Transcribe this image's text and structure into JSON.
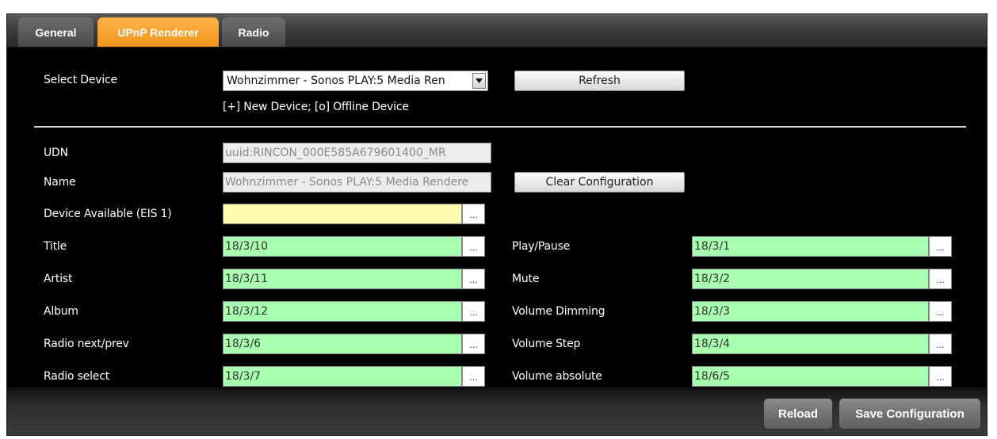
{
  "tabs": [
    {
      "label": "General",
      "active": false
    },
    {
      "label": "UPnP Renderer",
      "active": true
    },
    {
      "label": "Radio",
      "active": false
    }
  ],
  "select_device": {
    "label": "Select Device",
    "value": "Wohnzimmer - Sonos PLAY:5 Media Ren",
    "refresh_label": "Refresh",
    "hint": "[+] New Device; [o] Offline Device"
  },
  "udn": {
    "label": "UDN",
    "value": "uuid:RINCON_000E585A679601400_MR"
  },
  "name": {
    "label": "Name",
    "value": "Wohnzimmer - Sonos PLAY:5 Media Rendere",
    "clear_label": "Clear Configuration"
  },
  "device_available": {
    "label": "Device Available (EIS 1)",
    "value": ""
  },
  "left_fields": [
    {
      "label": "Title",
      "value": "18/3/10"
    },
    {
      "label": "Artist",
      "value": "18/3/11"
    },
    {
      "label": "Album",
      "value": "18/3/12"
    },
    {
      "label": "Radio next/prev",
      "value": "18/3/6"
    },
    {
      "label": "Radio select",
      "value": "18/3/7"
    }
  ],
  "right_fields": [
    {
      "label": "Play/Pause",
      "value": "18/3/1"
    },
    {
      "label": "Mute",
      "value": "18/3/2"
    },
    {
      "label": "Volume Dimming",
      "value": "18/3/3"
    },
    {
      "label": "Volume Step",
      "value": "18/3/4"
    },
    {
      "label": "Volume absolute",
      "value": "18/6/5"
    }
  ],
  "dots_label": "...",
  "footer": {
    "reload_label": "Reload",
    "save_label": "Save Configuration"
  },
  "colors": {
    "active_tab": "#f2941c",
    "green_field": "#a8ffaf",
    "yellow_field": "#fffeb0"
  }
}
